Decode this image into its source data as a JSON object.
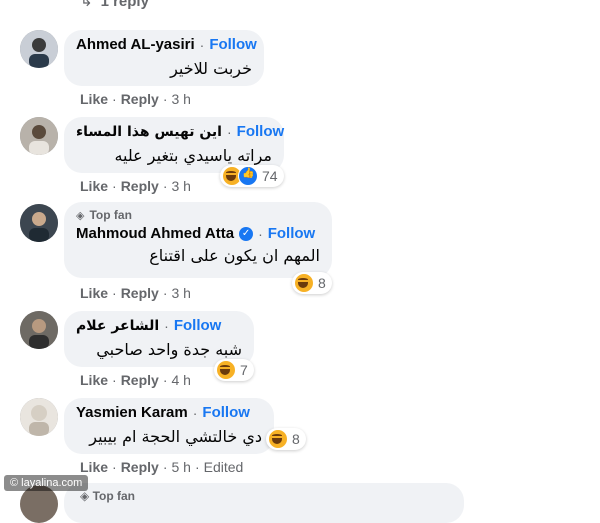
{
  "top_reply": {
    "arrow": "↳",
    "label": "1 reply"
  },
  "comments": [
    {
      "name": "Ahmed AL-yasiri",
      "follow": "Follow",
      "text": "خربت للاخير",
      "actions": {
        "like": "Like",
        "reply": "Reply",
        "time": "3 h"
      }
    },
    {
      "name": "اين تهيس هذا المساء",
      "follow": "Follow",
      "text": "مراته ياسيدي بتغير عليه",
      "actions": {
        "like": "Like",
        "reply": "Reply",
        "time": "3 h"
      },
      "reactions": {
        "icons": [
          "haha-icon",
          "like-icon"
        ],
        "count": "74"
      }
    },
    {
      "badge": "Top fan",
      "name": "Mahmoud Ahmed Atta",
      "verified": true,
      "follow": "Follow",
      "text": "المهم ان يكون على اقتناع",
      "actions": {
        "like": "Like",
        "reply": "Reply",
        "time": "3 h"
      },
      "reactions": {
        "icons": [
          "haha-icon"
        ],
        "count": "8"
      }
    },
    {
      "name": "الشاعر علام",
      "follow": "Follow",
      "text": "شبه جدة واحد صاحبي",
      "actions": {
        "like": "Like",
        "reply": "Reply",
        "time": "4 h"
      },
      "reactions": {
        "icons": [
          "haha-icon"
        ],
        "count": "7"
      }
    },
    {
      "name": "Yasmien Karam",
      "follow": "Follow",
      "text": "دي خالتشي الحجة ام بيبير",
      "actions": {
        "like": "Like",
        "reply": "Reply",
        "time": "5 h",
        "edited": "Edited"
      },
      "reactions": {
        "icons": [
          "haha-icon"
        ],
        "count": "8"
      }
    }
  ],
  "partial_comment": {
    "badge": "Top fan"
  },
  "watermark": "© layalina.com",
  "colors": {
    "link": "#1877f2",
    "bubble": "#f0f2f5",
    "muted": "#65676b"
  }
}
